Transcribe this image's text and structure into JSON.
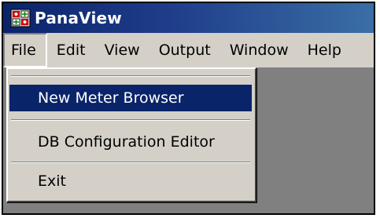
{
  "window": {
    "title": "PanaView",
    "icon": "panaview-app-icon"
  },
  "menubar": {
    "items": [
      "File",
      "Edit",
      "View",
      "Output",
      "Window",
      "Help"
    ],
    "active": "File"
  },
  "file_menu": {
    "items": [
      {
        "label": "New Meter Browser",
        "highlighted": true
      },
      {
        "label": "DB Configuration Editor",
        "highlighted": false
      },
      {
        "label": "Exit",
        "highlighted": false
      }
    ]
  },
  "colors": {
    "titlebar": "#0a246a",
    "menu_background": "#d4d0c8",
    "highlight": "#0a246a",
    "workspace": "#808080"
  }
}
